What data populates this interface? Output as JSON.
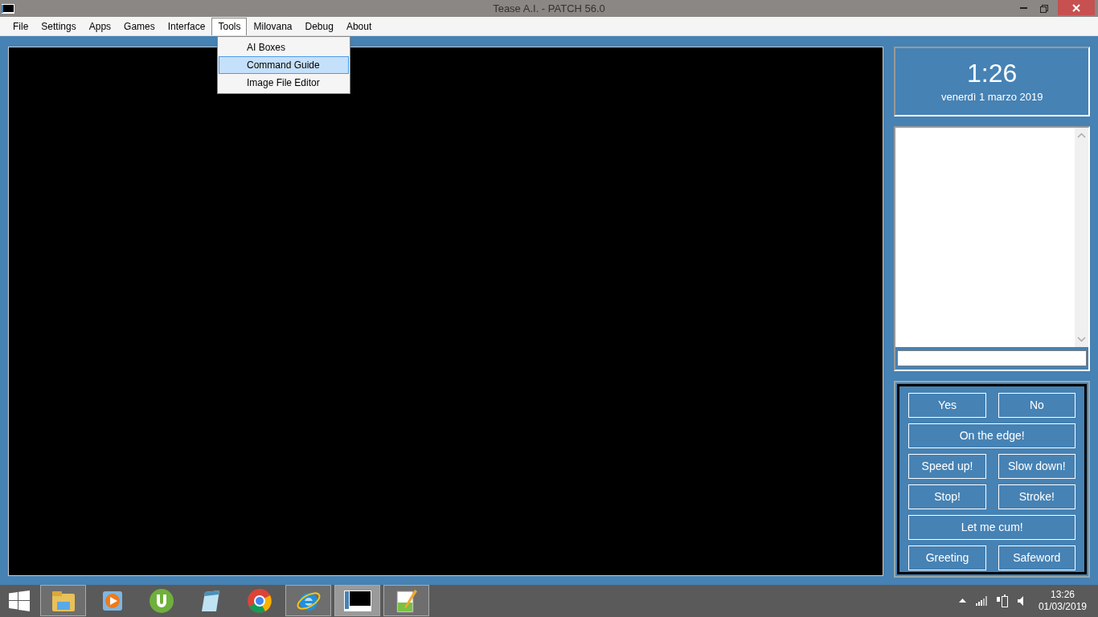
{
  "window": {
    "title": "Tease A.I. - PATCH 56.0"
  },
  "menu": [
    {
      "label": "File",
      "selected": false
    },
    {
      "label": "Settings",
      "selected": false
    },
    {
      "label": "Apps",
      "selected": false
    },
    {
      "label": "Games",
      "selected": false
    },
    {
      "label": "Interface",
      "selected": false
    },
    {
      "label": "Tools",
      "selected": true
    },
    {
      "label": "Milovana",
      "selected": false
    },
    {
      "label": "Debug",
      "selected": false
    },
    {
      "label": "About",
      "selected": false
    }
  ],
  "dropdown": [
    {
      "label": "AI Boxes",
      "selected": false
    },
    {
      "label": "Command Guide",
      "selected": true
    },
    {
      "label": "Image File Editor",
      "selected": false
    }
  ],
  "clock": {
    "time": "1:26",
    "date": "venerdì 1 marzo 2019"
  },
  "buttons": [
    {
      "label": "Yes",
      "kind": "half"
    },
    {
      "label": "No",
      "kind": "half"
    },
    {
      "label": "On the edge!",
      "kind": "wide"
    },
    {
      "label": "Speed up!",
      "kind": "half"
    },
    {
      "label": "Slow down!",
      "kind": "half"
    },
    {
      "label": "Stop!",
      "kind": "half"
    },
    {
      "label": "Stroke!",
      "kind": "half"
    },
    {
      "label": "Let me cum!",
      "kind": "wide"
    },
    {
      "label": "Greeting",
      "kind": "half"
    },
    {
      "label": "Safeword",
      "kind": "half"
    }
  ],
  "taskbar": [
    {
      "kind": "folder",
      "running": true,
      "active": false
    },
    {
      "kind": "media",
      "running": false,
      "active": false
    },
    {
      "kind": "torrent",
      "running": false,
      "active": false
    },
    {
      "kind": "notepad",
      "running": false,
      "active": false
    },
    {
      "kind": "chrome",
      "running": false,
      "active": false
    },
    {
      "kind": "ie",
      "running": true,
      "active": false
    },
    {
      "kind": "appwindow",
      "running": true,
      "active": true
    },
    {
      "kind": "editor",
      "running": true,
      "active": false
    }
  ],
  "tray": {
    "time": "13:26",
    "date": "01/03/2019"
  }
}
